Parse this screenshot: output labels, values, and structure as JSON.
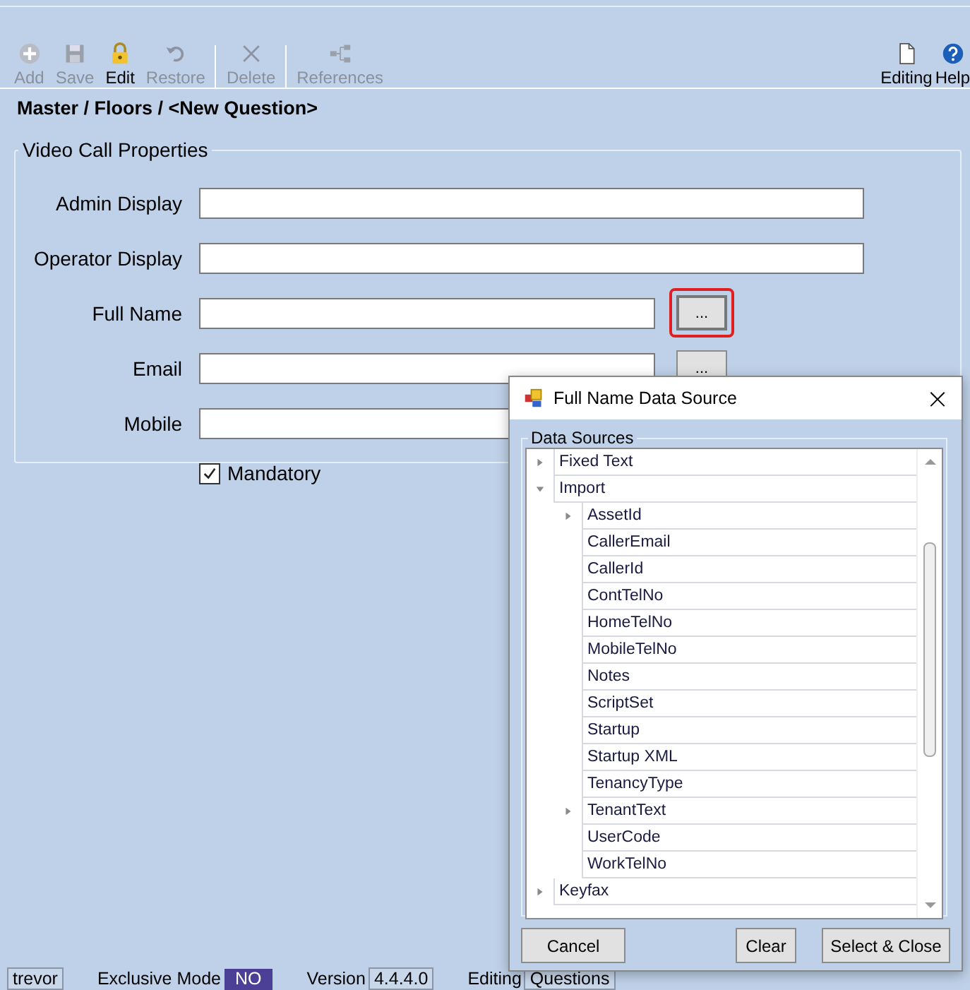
{
  "toolbar": {
    "items": [
      {
        "label": "Add",
        "disabled": true
      },
      {
        "label": "Save",
        "disabled": true
      },
      {
        "label": "Edit",
        "disabled": false
      },
      {
        "label": "Restore",
        "disabled": true
      },
      {
        "label": "Delete",
        "disabled": true
      },
      {
        "label": "References",
        "disabled": true
      }
    ],
    "right_items": [
      {
        "label": "Editing"
      },
      {
        "label": "Help"
      }
    ]
  },
  "breadcrumb": "Master / Floors / <New Question>",
  "group": {
    "title": "Video Call Properties",
    "fields": [
      {
        "label": "Admin Display",
        "kind": "text"
      },
      {
        "label": "Operator Display",
        "kind": "text"
      },
      {
        "label": "Full Name",
        "kind": "picker",
        "picker_label": "...",
        "highlighted": true
      },
      {
        "label": "Email",
        "kind": "picker",
        "picker_label": "...",
        "highlighted": false
      },
      {
        "label": "Mobile",
        "kind": "text"
      }
    ],
    "checkbox": {
      "label": "Mandatory",
      "checked": true
    }
  },
  "dialog": {
    "title": "Full Name Data Source",
    "close": "×",
    "group_title": "Data Sources",
    "tree": [
      {
        "label": "Fixed Text",
        "kind": "branch",
        "expanded": false
      },
      {
        "label": "Import",
        "kind": "branch",
        "expanded": true,
        "children": [
          {
            "label": "AssetId",
            "kind": "branch",
            "expanded": false
          },
          {
            "label": "CallerEmail",
            "kind": "leaf"
          },
          {
            "label": "CallerId",
            "kind": "leaf"
          },
          {
            "label": "ContTelNo",
            "kind": "leaf"
          },
          {
            "label": "HomeTelNo",
            "kind": "leaf"
          },
          {
            "label": "MobileTelNo",
            "kind": "leaf"
          },
          {
            "label": "Notes",
            "kind": "leaf"
          },
          {
            "label": "ScriptSet",
            "kind": "leaf"
          },
          {
            "label": "Startup",
            "kind": "leaf"
          },
          {
            "label": "Startup XML",
            "kind": "leaf"
          },
          {
            "label": "TenancyType",
            "kind": "leaf"
          },
          {
            "label": "TenantText",
            "kind": "branch",
            "expanded": false
          },
          {
            "label": "UserCode",
            "kind": "leaf"
          },
          {
            "label": "WorkTelNo",
            "kind": "leaf"
          }
        ]
      },
      {
        "label": "Keyfax",
        "kind": "branch",
        "expanded": false
      }
    ],
    "buttons": [
      "Cancel",
      "Clear",
      "Select & Close"
    ]
  },
  "status_bar": {
    "user": "trevor",
    "exclusive_label": "Exclusive Mode",
    "exclusive_value": "NO",
    "version_label": "Version",
    "version_value": "4.4.4.0",
    "editing_label": "Editing",
    "editing_value": "Questions"
  }
}
